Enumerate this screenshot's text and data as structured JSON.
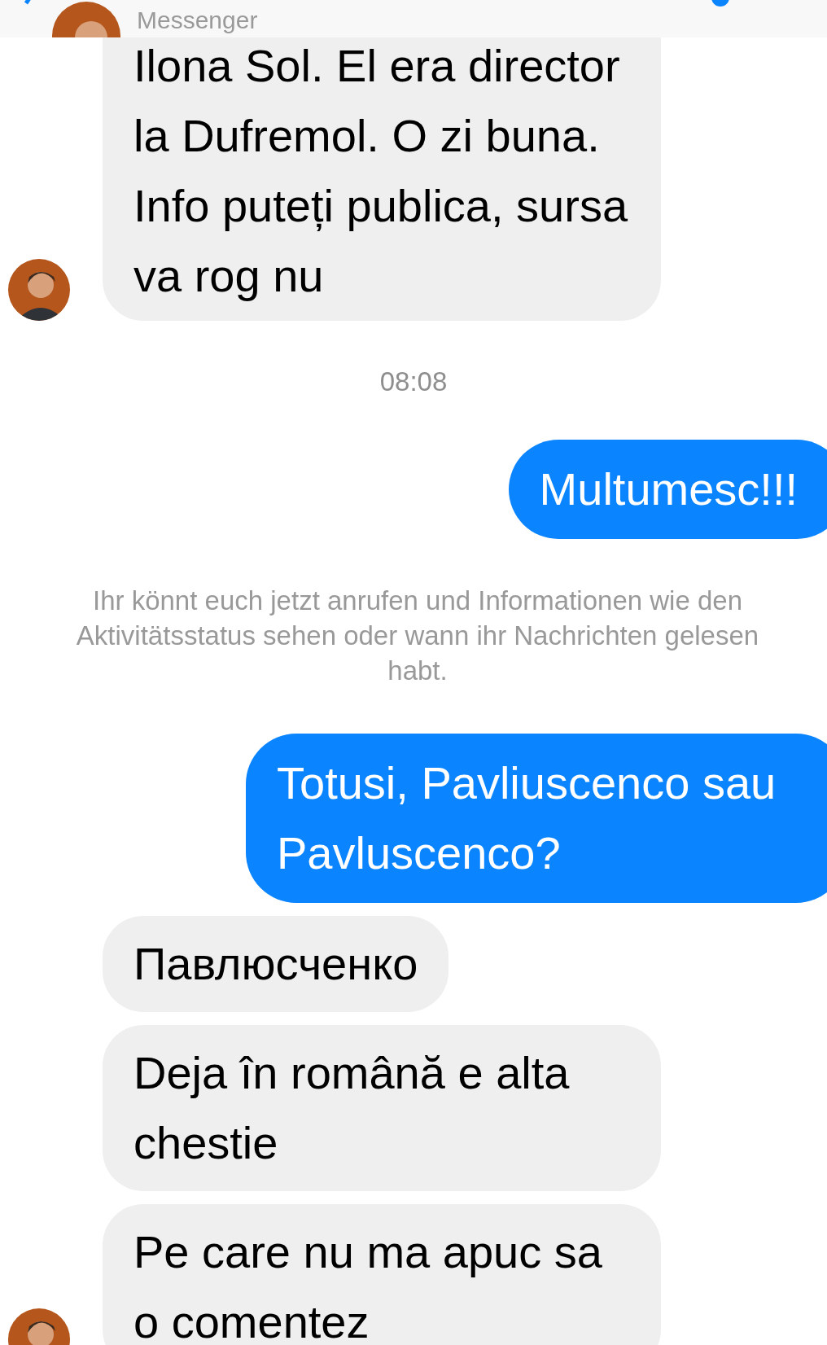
{
  "header": {
    "subtitle": "Messenger"
  },
  "messages": [
    {
      "kind": "incoming",
      "text": "Ilona Sol. El era director la Dufremol. O zi buna. Info puteți publica, sursa va rog nu",
      "avatar": true
    },
    {
      "kind": "time",
      "text": "08:08"
    },
    {
      "kind": "outgoing",
      "text": "Multumesc!!!"
    },
    {
      "kind": "notice",
      "text": "Ihr könnt euch jetzt anrufen und Informationen wie den Aktivitätsstatus sehen oder wann ihr Nachrichten gelesen habt."
    },
    {
      "kind": "outgoing",
      "text": "Totusi, Pavliuscenco sau Pavluscenco?"
    },
    {
      "kind": "incoming",
      "text": "Павлюсченко",
      "avatar": false
    },
    {
      "kind": "incoming",
      "text": "Deja în română e alta chestie",
      "avatar": false
    },
    {
      "kind": "incoming",
      "text": "Pe care nu ma apuc sa o comentez",
      "avatar": true
    }
  ]
}
